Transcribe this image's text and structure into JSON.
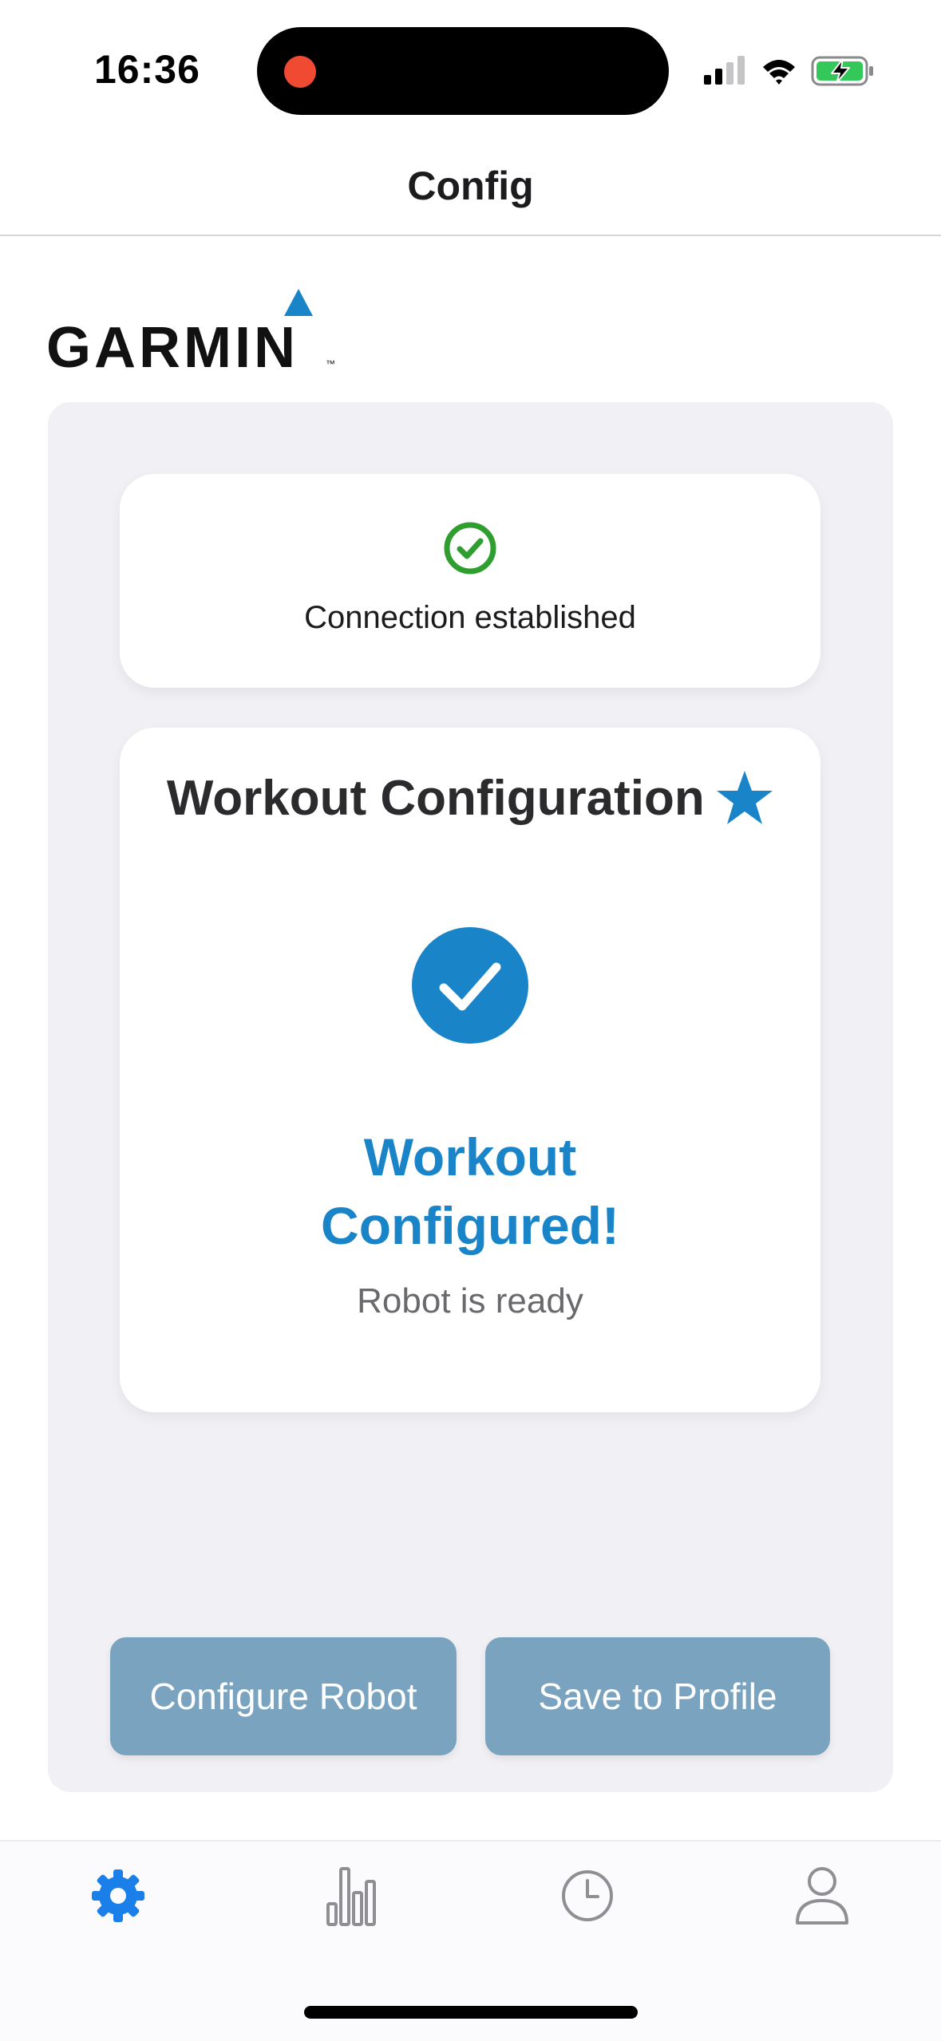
{
  "status_bar": {
    "time": "16:36",
    "icons": [
      "recording-dot",
      "cellular-signal-icon",
      "wifi-icon",
      "battery-charging-icon"
    ]
  },
  "header": {
    "title": "Config"
  },
  "logo": {
    "brand": "GARMIN",
    "trademark": "™"
  },
  "connection_card": {
    "text": "Connection established",
    "icon": "check-circle-icon"
  },
  "workout_card": {
    "title": "Workout Configuration",
    "title_icon": "star-icon",
    "status_icon": "check-circle-filled-icon",
    "status_line1": "Workout",
    "status_line2": "Configured!",
    "subtitle": "Robot is ready"
  },
  "buttons": {
    "configure_label": "Configure Robot",
    "save_label": "Save to Profile"
  },
  "tab_bar": {
    "items": [
      {
        "icon": "gear-icon",
        "active": true
      },
      {
        "icon": "bar-chart-icon",
        "active": false
      },
      {
        "icon": "clock-icon",
        "active": false
      },
      {
        "icon": "person-icon",
        "active": false
      }
    ]
  },
  "colors": {
    "accent": "#1a84c8",
    "button": "#7aa3bf",
    "panel": "#f1f0f4",
    "success": "#2e9e2e",
    "tab_active": "#1a7fe8",
    "tab_inactive": "#8e8e93"
  }
}
